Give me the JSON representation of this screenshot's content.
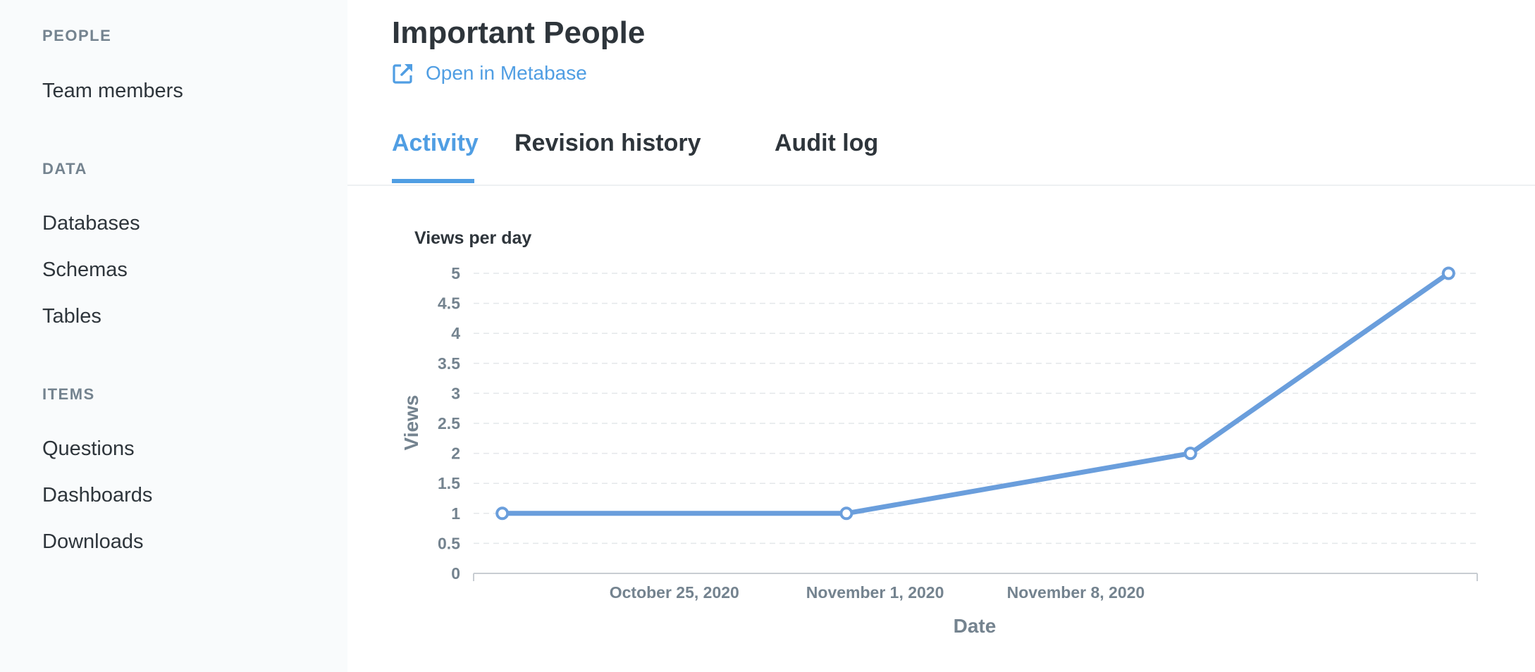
{
  "sidebar": {
    "sections": [
      {
        "title": "PEOPLE",
        "items": [
          "Team members"
        ]
      },
      {
        "title": "DATA",
        "items": [
          "Databases",
          "Schemas",
          "Tables"
        ]
      },
      {
        "title": "ITEMS",
        "items": [
          "Questions",
          "Dashboards",
          "Downloads"
        ]
      }
    ]
  },
  "header": {
    "title": "Important People",
    "open_link": "Open in Metabase",
    "open_icon": "external-link-icon"
  },
  "tabs": [
    {
      "label": "Activity",
      "active": true
    },
    {
      "label": "Revision history",
      "active": false
    },
    {
      "label": "Audit log",
      "active": false
    }
  ],
  "colors": {
    "accent": "#509ee3",
    "line": "#6a9edc",
    "text": "#2e353b",
    "muted": "#74838f",
    "sidebar_bg": "#f9fbfc"
  },
  "chart_data": {
    "type": "line",
    "title": "Views per day",
    "xlabel": "Date",
    "ylabel": "Views",
    "x": [
      "2020-10-19",
      "2020-10-31",
      "2020-11-12",
      "2020-11-21"
    ],
    "series": [
      {
        "values": [
          1,
          1,
          2,
          5
        ]
      }
    ],
    "ylim": [
      0,
      5
    ],
    "yticks": [
      "0",
      "0.5",
      "1",
      "1.5",
      "2",
      "2.5",
      "3",
      "3.5",
      "4",
      "4.5",
      "5"
    ],
    "xticks": [
      {
        "date": "2020-10-25",
        "label": "October 25, 2020"
      },
      {
        "date": "2020-11-01",
        "label": "November 1, 2020"
      },
      {
        "date": "2020-11-08",
        "label": "November 8, 2020"
      }
    ],
    "xlim": [
      "2020-10-18",
      "2020-11-22"
    ],
    "grid": true
  }
}
